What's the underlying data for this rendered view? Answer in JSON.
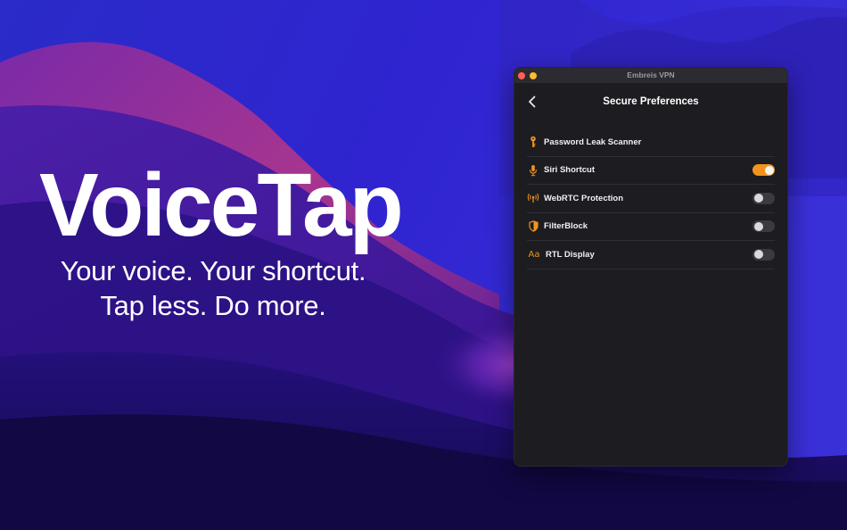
{
  "hero": {
    "title": "VoiceTap",
    "tagline_line1": "Your voice. Your shortcut.",
    "tagline_line2": "Tap less. Do more."
  },
  "window": {
    "title": "Embreis VPN"
  },
  "header": {
    "title": "Secure Preferences",
    "back_icon": "chevron-left-icon"
  },
  "settings": [
    {
      "label": "Password Leak Scanner",
      "icon": "key-icon",
      "has_toggle": false
    },
    {
      "label": "Siri Shortcut",
      "icon": "microphone-icon",
      "has_toggle": true,
      "enabled": true
    },
    {
      "label": "WebRTC Protection",
      "icon": "antenna-icon",
      "has_toggle": true,
      "enabled": false
    },
    {
      "label": "FilterBlock",
      "icon": "shield-icon",
      "has_toggle": true,
      "enabled": false
    },
    {
      "label": "RTL Display",
      "icon": "text-size-icon",
      "icon_text": "Aa",
      "has_toggle": true,
      "enabled": false
    }
  ],
  "colors": {
    "accent": "#f0941e",
    "window_bg": "#1c1c21",
    "titlebar_bg": "#2b2b31"
  }
}
